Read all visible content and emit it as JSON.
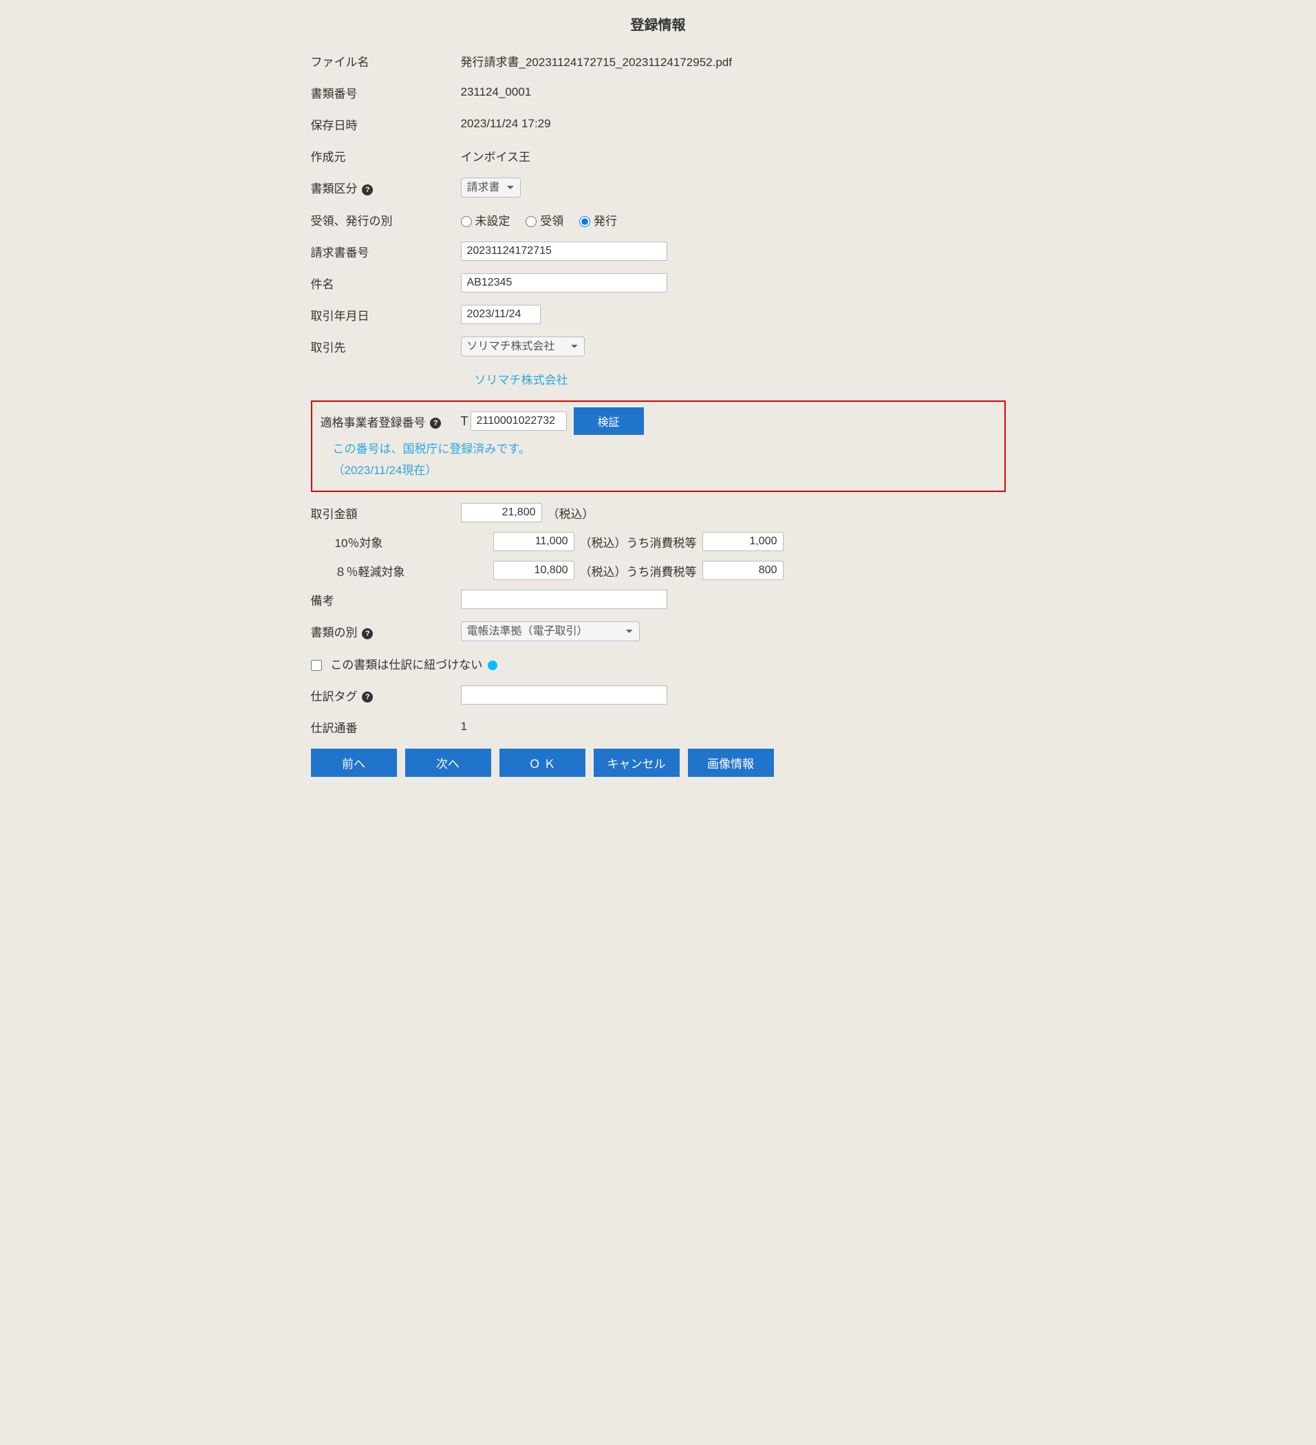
{
  "title": "登録情報",
  "labels": {
    "filename": "ファイル名",
    "doc_number": "書類番号",
    "saved_at": "保存日時",
    "created_by": "作成元",
    "doc_type": "書類区分",
    "receipt_issue": "受領、発行の別",
    "invoice_number": "請求書番号",
    "subject": "件名",
    "transaction_date": "取引年月日",
    "client": "取引先",
    "reg_number": "適格事業者登録番号",
    "amount": "取引金額",
    "ten_percent": "10％対象",
    "eight_percent": "８％軽減対象",
    "tax_incl": "（税込）",
    "tax_incl_etc": "（税込）うち消費税等",
    "notes": "備考",
    "doc_category": "書類の別",
    "no_link": "この書類は仕訳に紐づけない",
    "tag": "仕訳タグ",
    "seq": "仕訳通番"
  },
  "values": {
    "filename": "発行請求書_20231124172715_20231124172952.pdf",
    "doc_number": "231124_0001",
    "saved_at": "2023/11/24 17:29",
    "created_by": "インボイス王",
    "doc_type_selected": "請求書",
    "radio_unset": "未設定",
    "radio_receive": "受領",
    "radio_issue": "発行",
    "invoice_number": "20231124172715",
    "subject": "AB12345",
    "transaction_date": "2023/11/24",
    "client_selected": "ソリマチ株式会社",
    "client_link": "ソリマチ株式会社",
    "t_prefix": "T",
    "reg_number": "2110001022732",
    "verify_btn": "検証",
    "reg_status_line1": "この番号は、国税庁に登録済みです。",
    "reg_status_line2": "（2023/11/24現在）",
    "amount_total": "21,800",
    "amount_10": "11,000",
    "tax_10": "1,000",
    "amount_8": "10,800",
    "tax_8": "800",
    "doc_category_selected": "電帳法準拠（電子取引）",
    "seq": "1"
  },
  "buttons": {
    "prev": "前へ",
    "next": "次へ",
    "ok": "Ｏ Ｋ",
    "cancel": "キャンセル",
    "image_info": "画像情報"
  }
}
